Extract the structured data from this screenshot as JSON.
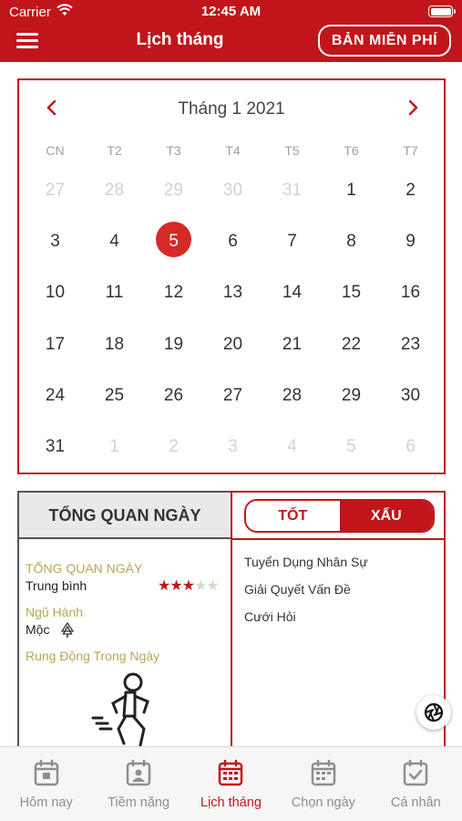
{
  "status_bar": {
    "carrier": "Carrier",
    "time": "12:45 AM"
  },
  "header": {
    "title": "Lịch tháng",
    "free_button": "BẢN MIỄN PHÍ",
    "menu_icon": "hamburger-icon"
  },
  "calendar": {
    "month_title": "Tháng 1 2021",
    "prev_icon": "chevron-left-icon",
    "next_icon": "chevron-right-icon",
    "weekdays": [
      "CN",
      "T2",
      "T3",
      "T4",
      "T5",
      "T6",
      "T7"
    ],
    "weeks": [
      [
        {
          "d": "27",
          "m": true
        },
        {
          "d": "28",
          "m": true
        },
        {
          "d": "29",
          "m": true
        },
        {
          "d": "30",
          "m": true
        },
        {
          "d": "31",
          "m": true
        },
        {
          "d": "1"
        },
        {
          "d": "2"
        }
      ],
      [
        {
          "d": "3"
        },
        {
          "d": "4"
        },
        {
          "d": "5",
          "sel": true
        },
        {
          "d": "6"
        },
        {
          "d": "7"
        },
        {
          "d": "8"
        },
        {
          "d": "9"
        }
      ],
      [
        {
          "d": "10"
        },
        {
          "d": "11"
        },
        {
          "d": "12"
        },
        {
          "d": "13"
        },
        {
          "d": "14"
        },
        {
          "d": "15"
        },
        {
          "d": "16"
        }
      ],
      [
        {
          "d": "17"
        },
        {
          "d": "18"
        },
        {
          "d": "19"
        },
        {
          "d": "20"
        },
        {
          "d": "21"
        },
        {
          "d": "22"
        },
        {
          "d": "23"
        }
      ],
      [
        {
          "d": "24"
        },
        {
          "d": "25"
        },
        {
          "d": "26"
        },
        {
          "d": "27"
        },
        {
          "d": "28"
        },
        {
          "d": "29"
        },
        {
          "d": "30"
        }
      ],
      [
        {
          "d": "31"
        },
        {
          "d": "1",
          "m": true
        },
        {
          "d": "2",
          "m": true
        },
        {
          "d": "3",
          "m": true
        },
        {
          "d": "4",
          "m": true
        },
        {
          "d": "5",
          "m": true
        },
        {
          "d": "6",
          "m": true
        }
      ]
    ],
    "selected_day": "5"
  },
  "overview": {
    "heading": "TỔNG QUAN NGÀY",
    "section1_label": "TỔNG QUAN NGÀY",
    "section1_value": "Trung bình",
    "rating": {
      "value": 3,
      "max": 5
    },
    "section2_label": "Ngũ Hành",
    "section2_value": "Mộc",
    "section3_label": "Rung Động Trong Ngày"
  },
  "good_bad": {
    "tab_good": "TỐT",
    "tab_bad": "XẤU",
    "active_tab": "XẤU",
    "items": [
      "Tuyển Dụng Nhân Sự",
      "Giải Quyết Vấn Đề",
      "Cưới Hỏi"
    ]
  },
  "tabbar": {
    "tabs": [
      {
        "label": "Hôm nay",
        "icon": "today-icon"
      },
      {
        "label": "Tiềm năng",
        "icon": "profile-calendar-icon"
      },
      {
        "label": "Lịch tháng",
        "icon": "month-calendar-icon",
        "active": true
      },
      {
        "label": "Chọn ngày",
        "icon": "choose-day-icon"
      },
      {
        "label": "Cá nhân",
        "icon": "personal-check-icon"
      }
    ]
  },
  "colors": {
    "brand_red": "#c0161b",
    "gold_label": "#b9a65a",
    "muted_day": "#d2d2d2"
  }
}
